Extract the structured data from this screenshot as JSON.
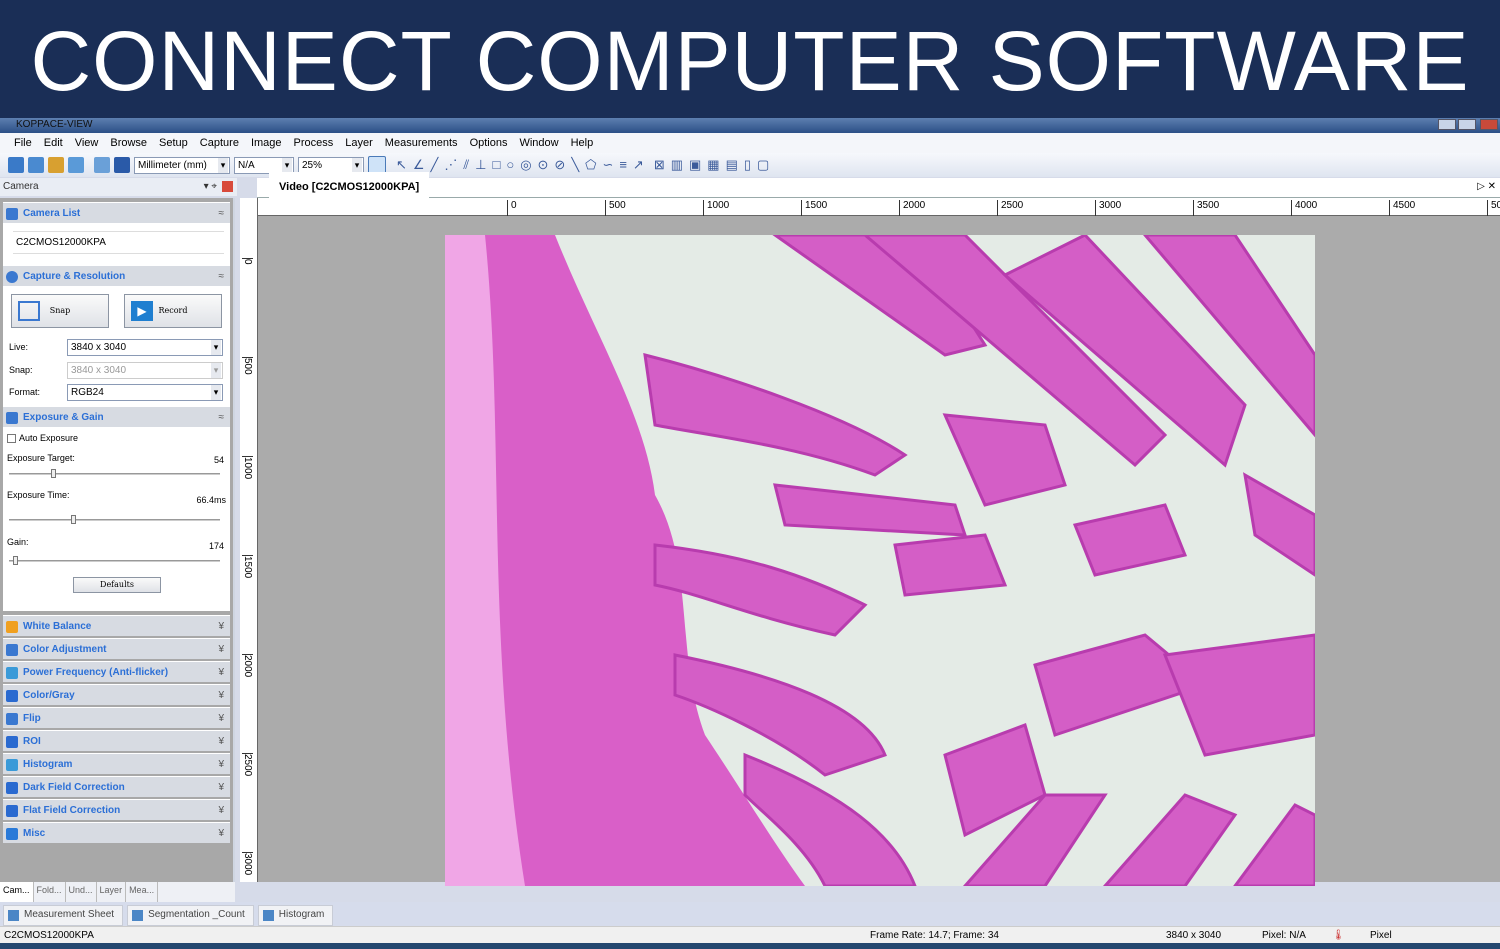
{
  "banner": {
    "text": "CONNECT COMPUTER SOFTWARE"
  },
  "window": {
    "title": "KOPPACE-VIEW"
  },
  "menu": [
    "File",
    "Edit",
    "View",
    "Browse",
    "Setup",
    "Capture",
    "Image",
    "Process",
    "Layer",
    "Measurements",
    "Options",
    "Window",
    "Help"
  ],
  "toolbar": {
    "unit": "Millimeter (mm)",
    "calibration": "N/A",
    "zoom": "25%"
  },
  "panel": {
    "title": "Camera",
    "camera_list": {
      "title": "Camera List",
      "camera": "C2CMOS12000KPA"
    },
    "capture": {
      "title": "Capture & Resolution",
      "snap": "Snap",
      "record": "Record",
      "live_label": "Live:",
      "live": "3840 x 3040",
      "snap_label": "Snap:",
      "snap_res": "3840 x 3040",
      "format_label": "Format:",
      "format": "RGB24"
    },
    "exposure": {
      "title": "Exposure & Gain",
      "auto": "Auto Exposure",
      "auto_checked": false,
      "target_label": "Exposure Target:",
      "target": "54",
      "time_label": "Exposure Time:",
      "time": "66.4ms",
      "gain_label": "Gain:",
      "gain": "174",
      "defaults": "Defaults"
    },
    "sections": [
      "White Balance",
      "Color Adjustment",
      "Power Frequency (Anti-flicker)",
      "Color/Gray",
      "Flip",
      "ROI",
      "Histogram",
      "Dark Field Correction",
      "Flat Field Correction",
      "Misc"
    ],
    "section_colors": [
      "#f0a020",
      "#3a78d0",
      "#3a9ad8",
      "#2a6ad0",
      "#3a78d0",
      "#2a6ad0",
      "#3a9ad8",
      "#2a6ad0",
      "#2a6ad0",
      "#2a7ad8"
    ],
    "tabs": [
      "Cam...",
      "Fold...",
      "Und...",
      "Layer",
      "Mea..."
    ]
  },
  "document": {
    "tab": "Video [C2CMOS12000KPA]",
    "ruler_top": [
      "0",
      "500",
      "1000",
      "1500",
      "2000",
      "2500",
      "3000",
      "3500",
      "4000",
      "4500",
      "50"
    ],
    "ruler_left": [
      "0",
      "500",
      "1000",
      "1500",
      "2000",
      "2500",
      "3000"
    ]
  },
  "bottom_tabs": [
    "Measurement Sheet",
    "Segmentation _Count",
    "Histogram"
  ],
  "status": {
    "camera": "C2CMOS12000KPA",
    "frame": "Frame Rate: 14.7; Frame: 34",
    "resolution": "3840 x 3040",
    "pixel": "Pixel: N/A",
    "unit": "Pixel"
  }
}
